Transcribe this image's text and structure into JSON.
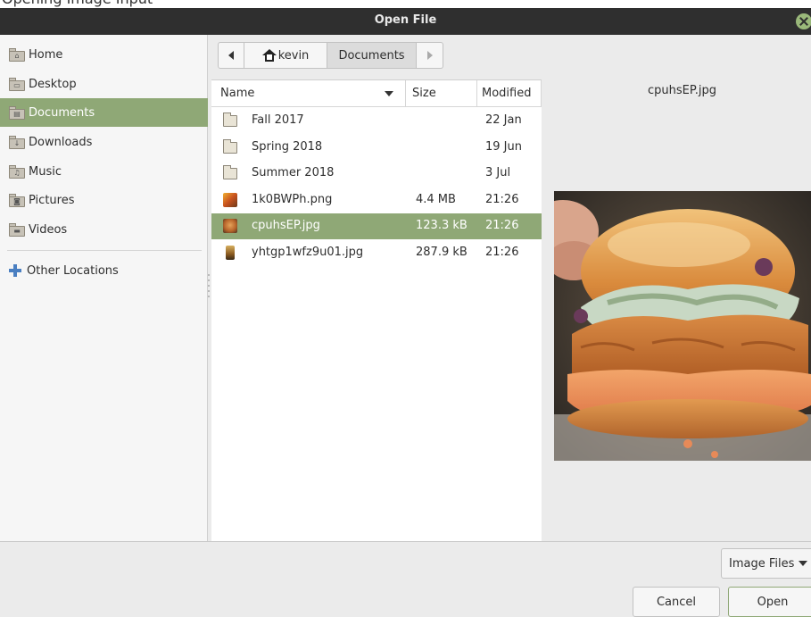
{
  "background_caption": "Opening Image Input",
  "window": {
    "title": "Open File"
  },
  "sidebar": {
    "items": [
      {
        "label": "Home",
        "icon": "home-folder-icon"
      },
      {
        "label": "Desktop",
        "icon": "desktop-folder-icon"
      },
      {
        "label": "Documents",
        "icon": "documents-folder-icon",
        "selected": true
      },
      {
        "label": "Downloads",
        "icon": "downloads-folder-icon"
      },
      {
        "label": "Music",
        "icon": "music-folder-icon"
      },
      {
        "label": "Pictures",
        "icon": "pictures-folder-icon"
      },
      {
        "label": "Videos",
        "icon": "videos-folder-icon"
      }
    ],
    "other_locations": "Other Locations"
  },
  "pathbar": {
    "home": "kevin",
    "current": "Documents"
  },
  "columns": {
    "name": "Name",
    "size": "Size",
    "modified": "Modified"
  },
  "files": [
    {
      "name": "Fall 2017",
      "size": "",
      "modified": "22 Jan",
      "type": "folder"
    },
    {
      "name": "Spring 2018",
      "size": "",
      "modified": "19 Jun",
      "type": "folder"
    },
    {
      "name": "Summer 2018",
      "size": "",
      "modified": "3 Jul",
      "type": "folder"
    },
    {
      "name": "1k0BWPh.png",
      "size": "4.4 MB",
      "modified": "21:26",
      "type": "image"
    },
    {
      "name": "cpuhsEP.jpg",
      "size": "123.3 kB",
      "modified": "21:26",
      "type": "image",
      "selected": true
    },
    {
      "name": "yhtgp1wfz9u01.jpg",
      "size": "287.9 kB",
      "modified": "21:26",
      "type": "image"
    }
  ],
  "preview": {
    "filename": "cpuhsEP.jpg"
  },
  "filter": {
    "label": "Image Files"
  },
  "actions": {
    "cancel": "Cancel",
    "open": "Open"
  },
  "colors": {
    "accent": "#8fa876",
    "titlebar": "#2f2f2f"
  }
}
